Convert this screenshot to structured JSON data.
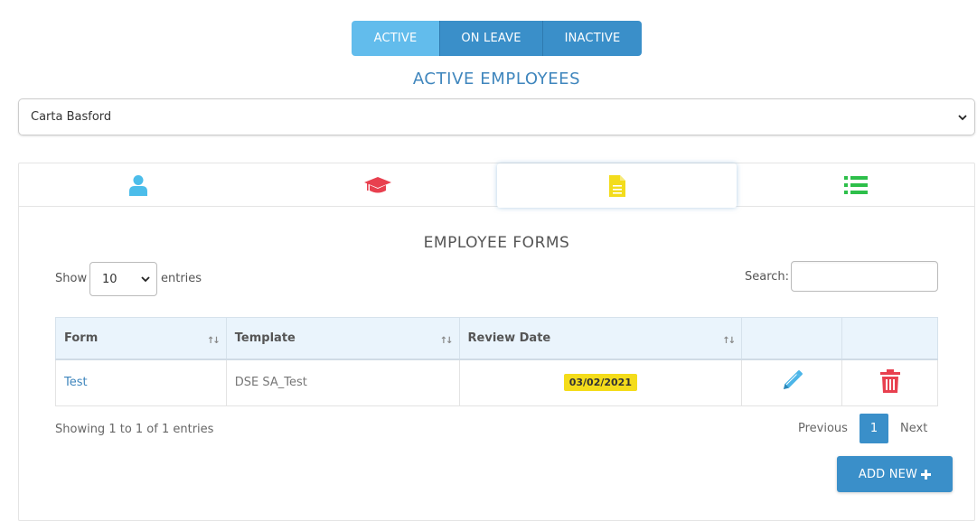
{
  "status_tabs": [
    {
      "label": "ACTIVE",
      "selected": true
    },
    {
      "label": "ON LEAVE",
      "selected": false
    },
    {
      "label": "INACTIVE",
      "selected": false
    }
  ],
  "page_title": "ACTIVE EMPLOYEES",
  "employee_select": {
    "value": "Carta Basford"
  },
  "detail_tabs": [
    {
      "icon": "user-icon",
      "color": "#4cbdea"
    },
    {
      "icon": "graduation-cap-icon",
      "color": "#e8404f"
    },
    {
      "icon": "document-icon",
      "color": "#f3dc1c",
      "selected": true
    },
    {
      "icon": "list-icon",
      "color": "#2dbf4a"
    }
  ],
  "section_title": "EMPLOYEE FORMS",
  "length_control": {
    "show_label": "Show",
    "value": "10",
    "entries_label": "entries"
  },
  "search": {
    "label": "Search:",
    "value": ""
  },
  "table": {
    "columns": [
      "Form",
      "Template",
      "Review Date",
      "",
      ""
    ],
    "rows": [
      {
        "form": "Test",
        "template": "DSE SA_Test",
        "review_date": "03/02/2021"
      }
    ]
  },
  "info_text": "Showing 1 to 1 of 1 entries",
  "pagination": {
    "previous": "Previous",
    "current_page": "1",
    "next": "Next"
  },
  "add_button": {
    "label": "ADD NEW"
  },
  "colors": {
    "accent": "#3a8fc9",
    "accent_light": "#62bcec",
    "edit": "#4cb5e8",
    "delete": "#e8404f",
    "badge": "#f4dc1a"
  }
}
